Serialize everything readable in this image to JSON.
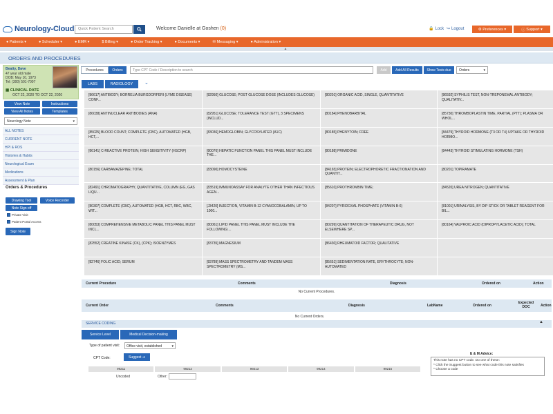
{
  "header": {
    "logo": "Neurology-Cloud",
    "search_placeholder": "Quick Patient Search",
    "welcome_prefix": "Welcome Danielle at Goshen",
    "welcome_count": "(0)",
    "lock": "Lock",
    "logout": "Logout",
    "preferences": "Preferences",
    "support": "Support"
  },
  "nav": [
    "Patients",
    "Scheduler",
    "EMR",
    "Billing",
    "Order Tracking",
    "Documents",
    "Messaging",
    "Administration"
  ],
  "page_title": "ORDERS AND PROCEDURES",
  "patient": {
    "name": "Beatty, Dave",
    "age": "47 year old male",
    "dob": "DOB: May 10, 1973",
    "tel": "Tel: (300) 501-7007",
    "clinical_date_label": "CLINICAL DATE",
    "clinical_date": "OCT 22, 2020 TO OCT 22, 2020"
  },
  "sidebar": {
    "buttons": [
      "View Note",
      "Instructions",
      "View All Notes",
      "Templates"
    ],
    "note_select": "Neurology Note",
    "links": [
      "ALL NOTES",
      "CURRENT NOTE",
      "HPI & ROS",
      "Histories & Habits",
      "Neurological Exam",
      "Medications",
      "Assessment & Plan"
    ],
    "orders_heading": "Orders & Procedures",
    "tool_buttons": [
      "Drawing Tool",
      "Voice Recorder",
      "Note Sign off"
    ],
    "checks": [
      "Private Visit",
      "Patient Portal Access"
    ],
    "sign_note": "Sign Note"
  },
  "main": {
    "tab_procedures": "Procedures",
    "tab_orders": "Orders",
    "cpt_placeholder": "Type CPT Code / Description to search",
    "add": "Add",
    "add_all": "Add All Results",
    "show_tests": "Show Tests due",
    "orders_select": "Orders",
    "labs": "LABS",
    "radiology": "RADIOLOGY"
  },
  "lab_tests": [
    "[86617] ANTIBODY; BORRELIA BURGDORFERI (LYME DISEASE) CONF...",
    "[82950] GLUCOSE; POST GLUCOSE DOSE (INCLUDES GLUCOSE)",
    "[80201] ORGANIC ACID, SINGLE, QUANTITATIVE",
    "[86592] SYPHILIS TEST, NON-TREPONEMAL ANTIBODY; QUALITATIV...",
    "[86038] ANTINUCLEAR ANTIBODIES (ANA)",
    "[82951] GLUCOSE; TOLERANCE TEST (GTT), 3 SPECIMENS (INCLUD...",
    "[80184] PHENOBARBITAL",
    "[85730] THROMBOPLASTIN TIME, PARTIAL (PTT); PLASMA OR WHOL...",
    "[85025] BLOOD COUNT; COMPLETE (CBC), AUTOMATED (HGB, HCT,...",
    "[83036] HEMOGLOBIN; GLYCOSYLATED (A1C)",
    "[80185] PHENYTOIN; FREE",
    "[84479] THYROID HORMONE (T3 OR T4) UPTAKE OR THYROID HORMO...",
    "[86141] C-REACTIVE PROTEIN; HIGH SENSITIVITY (HSCRP)",
    "[80076] HEPATIC FUNCTION PANEL THIS PANEL MUST INCLUDE THE...",
    "[80188] PRIMIDONE",
    "[84443] THYROID STIMULATING HORMONE (TSH)",
    "[80156] CARBAMAZEPINE; TOTAL",
    "[83090] HOMOCYSTEINE",
    "[84165] PROTEIN; ELECTROPHORETIC FRACTIONATION AND QUANTIT...",
    "[80201] TOPIRAMATE",
    "[82491] CHROMATOGRAPHY, QUANTITATIVE, COLUMN (EG, GAS LIQU...",
    "[83519] IMMUNOASSAY FOR ANALYTE OTHER THAN INFECTIOUS AGEN...",
    "[85610] PROTHROMBIN TIME;",
    "[84520] UREA NITROGEN; QUANTITATIVE",
    "[80307] COMPLETE (CBC), AUTOMATED (HGB, HCT, RBC, WBC, WIT...",
    "[J3420] INJECTION, VITAMIN B-12 CYANOCOBALAMIN, UP TO 1000...",
    "[84207] PYRIDOXAL PHOSPHATE (VITAMIN B-6)",
    "[81001] URINALYSIS, BY DIP STICK OR TABLET REAGENT FOR BIL...",
    "[80053] COMPREHENSIVE METABOLIC PANEL THIS PANEL MUST INCL...",
    "[80061] LIPID PANEL THIS PANEL MUST INCLUDE THE FOLLOWING:...",
    "[80299] QUANTITATION OF THERAPEUTIC DRUG, NOT ELSEWHERE SP...",
    "[80164] VALPROIC ACID (DIPROPYLACETIC ACID); TOTAL",
    "[82552] CREATINE KINASE (CK), (CPK); ISOENZYMES",
    "[83735] MAGNESIUM",
    "[86430] RHEUMATOID FACTOR; QUALITATIVE",
    "",
    "[82746] FOLIC ACID; SERUM",
    "[83789] MASS SPECTROMETRY AND TANDEM MASS SPECTROMETRY (MS...",
    "[85651] SEDIMENTATION RATE, ERYTHROCYTE; NON-AUTOMATED",
    ""
  ],
  "procedures_table": {
    "headers": [
      "Current Procedure",
      "Comments",
      "Diagnosis",
      "Ordered on",
      "Action"
    ],
    "empty": "No Current Procedures."
  },
  "orders_table": {
    "headers": [
      "Current Order",
      "Comments",
      "Diagnosis",
      "LabName",
      "Ordered on",
      "Expected DOC",
      "Action"
    ],
    "empty": "No Current Orders."
  },
  "service_coding": {
    "title": "SERVICE CODING",
    "service_level": "Service Level",
    "mdm": "Medical Decision-making",
    "visit_label": "Type of patient visit:",
    "visit_value": "Office visit, established",
    "cpt_label": "CPT Code:",
    "suggest": "Suggest",
    "codes": [
      "99211",
      "99212",
      "99213",
      "99214",
      "99215"
    ],
    "uncoded": "Uncoded",
    "other": "Other:",
    "em_title": "E & M Advice:",
    "em_lines": [
      "This note has no CPT code. Do one of these:",
      "* Click the Suggest button to see what code this note satisfies",
      "* Choose a code"
    ]
  }
}
